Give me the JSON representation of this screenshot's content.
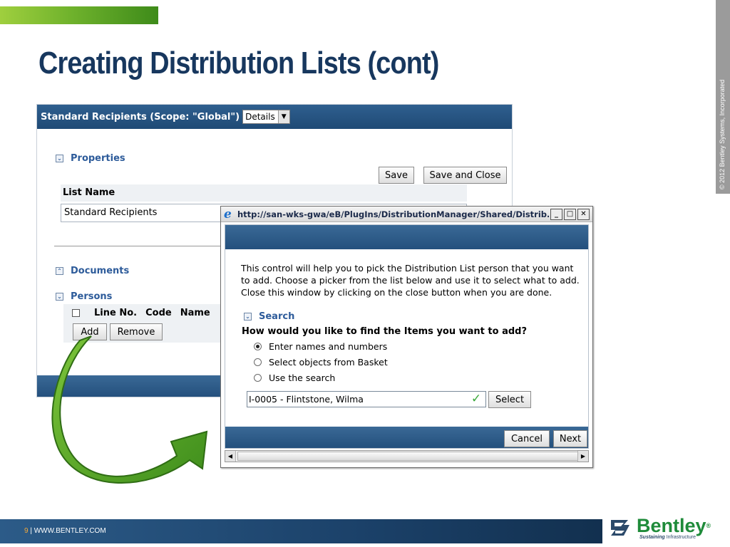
{
  "slide": {
    "title": "Creating Distribution Lists (cont)",
    "copyright": "© 2012 Bentley Systems, Incorporated",
    "footer_page": "9",
    "footer_site": "| WWW.BENTLEY.COM",
    "logo_text": "Bentley",
    "logo_reg": "®",
    "logo_tag_bold": "Sustaining",
    "logo_tag": "Infrastructure"
  },
  "form": {
    "header_title": "Standard Recipients (Scope: \"Global\")",
    "view_select": "Details",
    "sections": {
      "properties": "Properties",
      "documents": "Documents",
      "persons": "Persons"
    },
    "save_label": "Save",
    "save_close_label": "Save and Close",
    "list_name_label": "List Name",
    "list_name_value": "Standard Recipients",
    "persons_columns": [
      "Line No.",
      "Code",
      "Name"
    ],
    "add_label": "Add",
    "remove_label": "Remove"
  },
  "popup": {
    "url": "http://san-wks-gwa/eB/PlugIns/DistributionManager/Shared/Distrib...",
    "description": "This control will help you to pick the Distribution List person that you want to add. Choose a picker from the list below and use it to select what to add. Close this window by clicking on the close button when you are done.",
    "search_label": "Search",
    "question": "How would you like to find the Items you want to add?",
    "options": [
      "Enter names and numbers",
      "Select objects from Basket",
      "Use the search"
    ],
    "selected_option": 0,
    "picker_value": "I-0005  - Flintstone, Wilma",
    "select_label": "Select",
    "cancel_label": "Cancel",
    "next_label": "Next"
  },
  "colors": {
    "title_navy": "#17375e",
    "header_blue": "#24507d",
    "section_blue": "#2d5b9a",
    "arrow_green": "#5aa628",
    "logo_green": "#1f8b3a"
  }
}
